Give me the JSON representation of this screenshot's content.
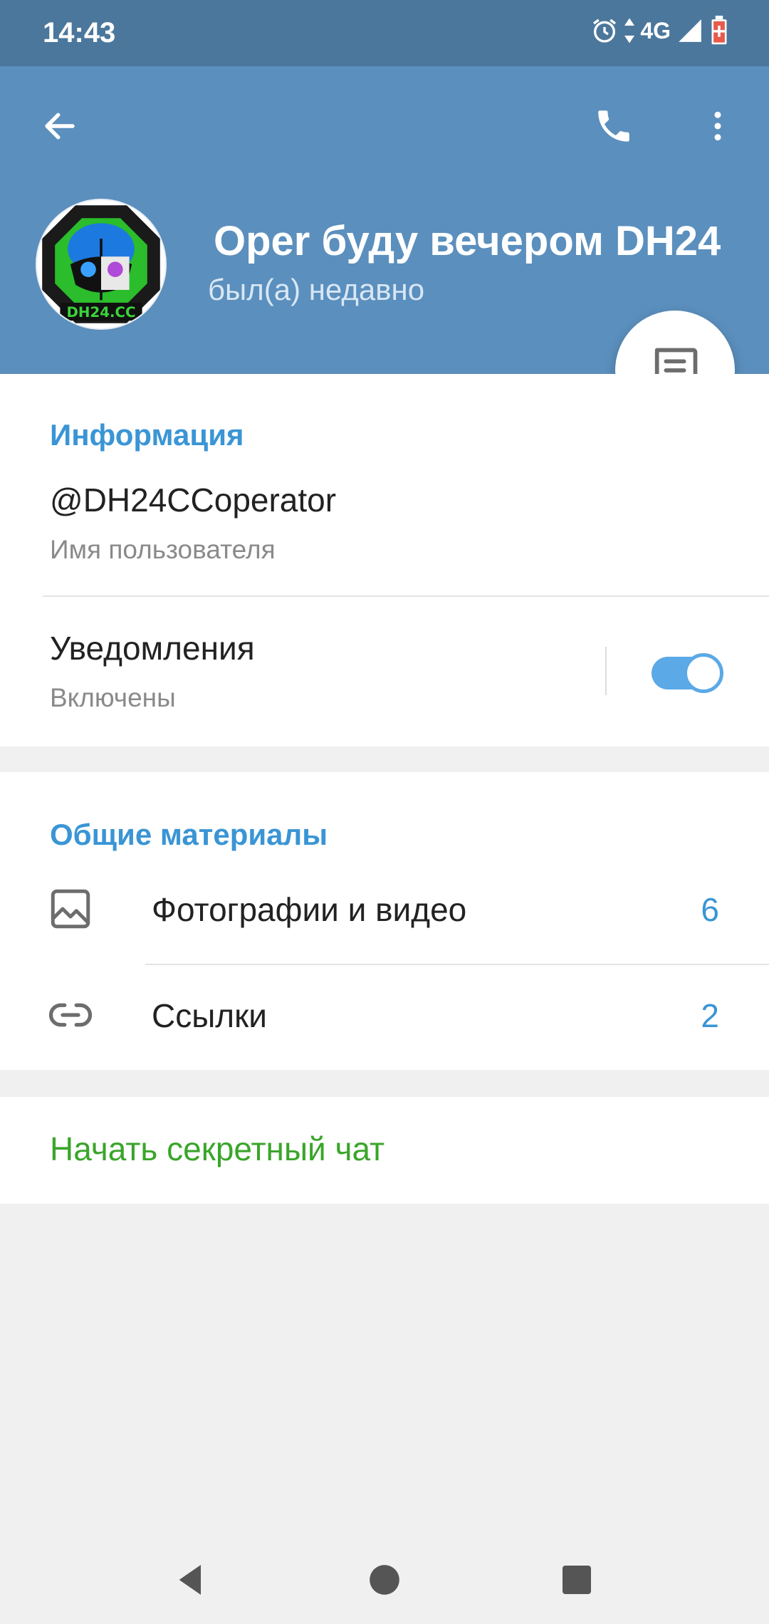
{
  "status_bar": {
    "time": "14:43",
    "network": "4G"
  },
  "header": {
    "name": "Oper    буду вечером DH24",
    "status": "был(а) недавно",
    "avatar_text": "DH24.CC"
  },
  "info": {
    "title": "Информация",
    "username": "@DH24CCoperator",
    "username_label": "Имя пользователя",
    "notifications": "Уведомления",
    "notifications_state": "Включены",
    "notifications_on": true
  },
  "media": {
    "title": "Общие материалы",
    "items": [
      {
        "icon": "image-icon",
        "label": "Фотографии и видео",
        "count": "6"
      },
      {
        "icon": "link-icon",
        "label": "Ссылки",
        "count": "2"
      }
    ]
  },
  "secret_chat": {
    "label": "Начать секретный чат"
  },
  "colors": {
    "status_bar": "#4b779c",
    "header": "#5b8fbd",
    "accent": "#3a95d5",
    "secret": "#3aa52a",
    "background": "#f0f0f0"
  }
}
